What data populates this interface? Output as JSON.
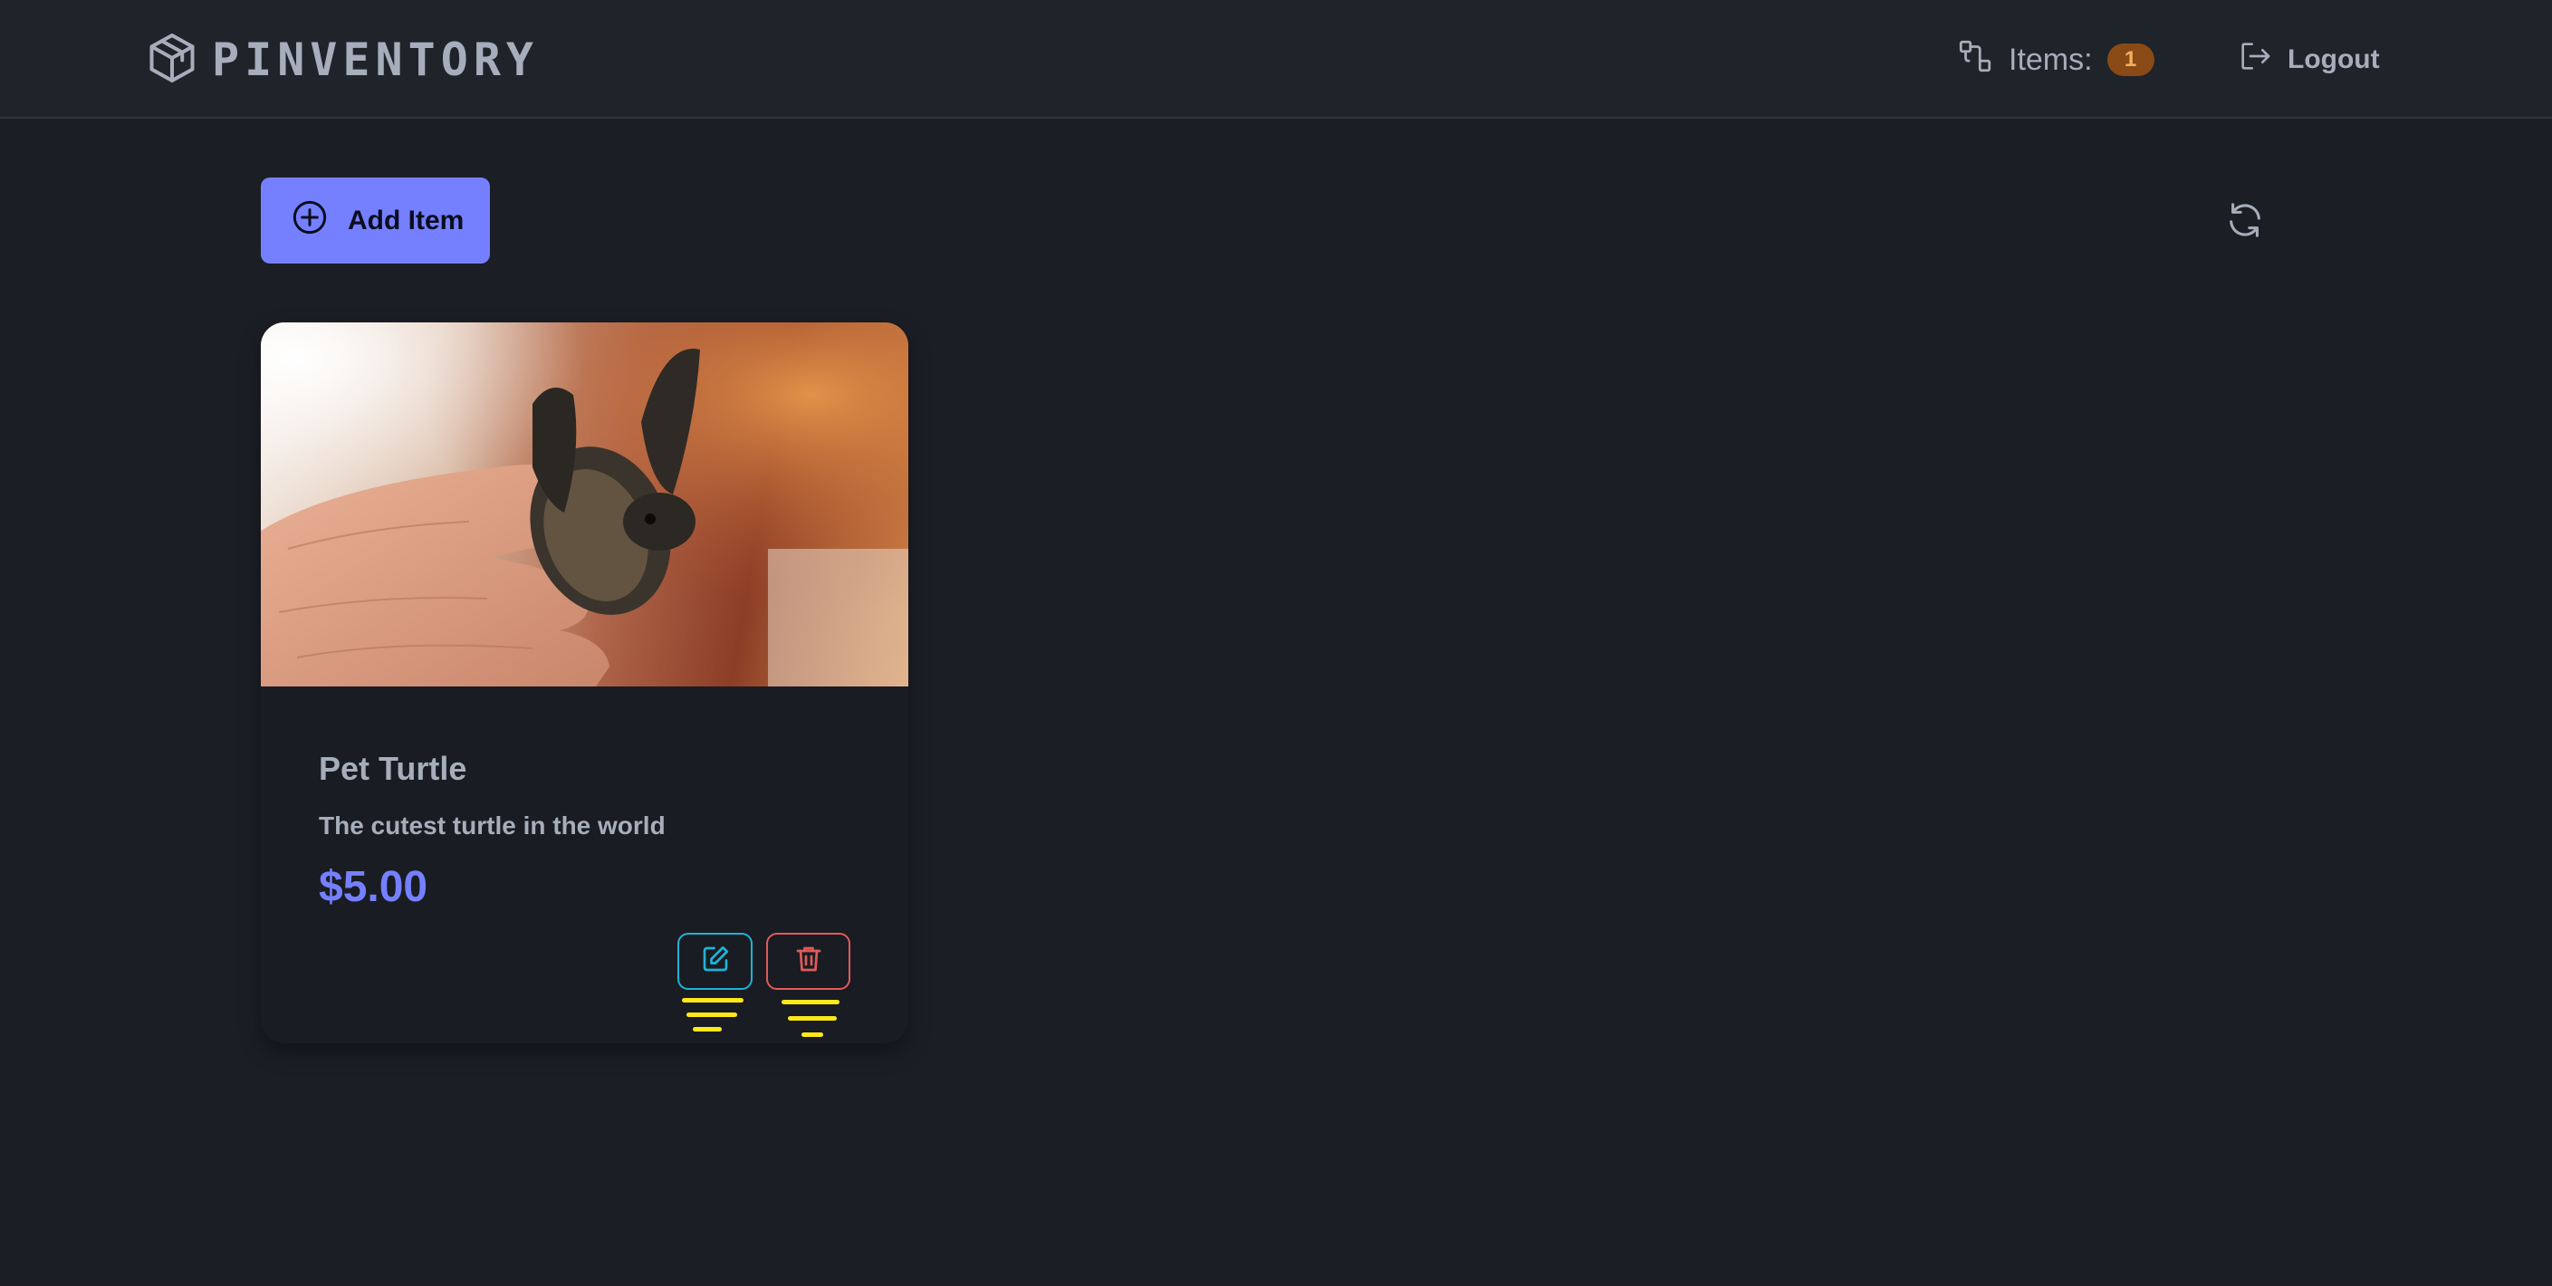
{
  "navbar": {
    "brand": "PINVENTORY",
    "items_label": "Items:",
    "items_count": "1",
    "logout_label": "Logout"
  },
  "toolbar": {
    "add_item_label": "Add Item"
  },
  "items": [
    {
      "title": "Pet Turtle",
      "description": "The cutest turtle in the world",
      "price": "$5.00"
    }
  ],
  "icons": {
    "logo": "box-icon",
    "items": "items-icon",
    "logout": "logout-icon",
    "add": "plus-circle-icon",
    "refresh": "refresh-icon",
    "edit": "edit-icon",
    "delete": "trash-icon"
  },
  "colors": {
    "background": "#1b1e24",
    "navbar": "#1f232a",
    "primary": "#7480ff",
    "badge": "#8a4a16",
    "edit": "#1fb2d8",
    "delete": "#e05a5a",
    "highlight": "#ffe81a"
  }
}
